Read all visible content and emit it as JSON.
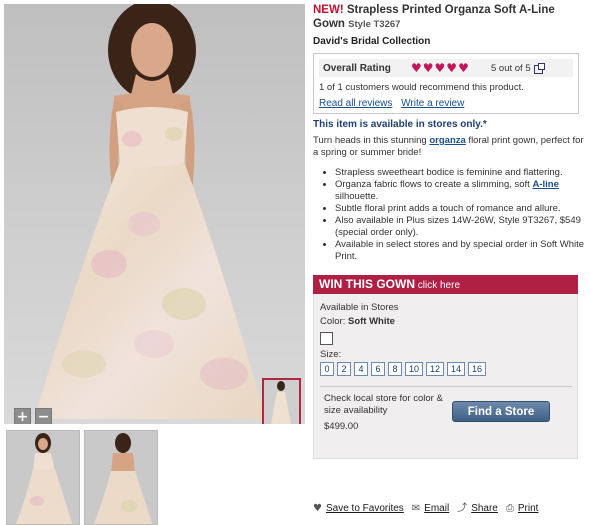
{
  "product": {
    "new_badge": "NEW!",
    "title": "Strapless Printed Organza Soft A-Line Gown",
    "style_label": "Style T3267",
    "brand": "David's Bridal Collection"
  },
  "rating": {
    "label": "Overall Rating",
    "hearts": 5,
    "summary": "5 out of 5",
    "recommend": "1 of 1 customers would recommend this product.",
    "read_reviews": "Read all reviews",
    "write_review": "Write a review",
    "heart_color": "#c2185b"
  },
  "availability_note": "This item is available in stores only.*",
  "description": {
    "pre": "Turn heads in this stunning ",
    "link": "organza",
    "post": " floral print gown, perfect for a spring or summer bride!"
  },
  "bullets": {
    "b1": "Strapless sweetheart bodice is feminine and flattering.",
    "b2_pre": "Organza fabric flows to create a slimming, soft ",
    "b2_link": "A-line",
    "b2_post": " silhouette.",
    "b3": "Subtle floral print adds a touch of romance and allure.",
    "b4": "Also available in Plus sizes 14W-26W, Style 9T3267, $549 (special order only).",
    "b5": "Available in select stores and by special order in Soft White Print."
  },
  "win": {
    "big": "WIN THIS GOWN",
    "small": " click here",
    "color": "#b01f44"
  },
  "store": {
    "available": "Available in Stores",
    "color_label": "Color: ",
    "color_value": "Soft White",
    "size_label": "Size:",
    "sizes": [
      "0",
      "2",
      "4",
      "6",
      "8",
      "10",
      "12",
      "14",
      "16"
    ],
    "check_text": "Check local store for color & size availability",
    "price": "$499.00",
    "find_button": "Find a Store"
  },
  "share": {
    "favorites": "Save to Favorites",
    "email": "Email",
    "share": "Share",
    "print": "Print"
  },
  "zoom": {
    "plus": "+",
    "minus": "−"
  }
}
